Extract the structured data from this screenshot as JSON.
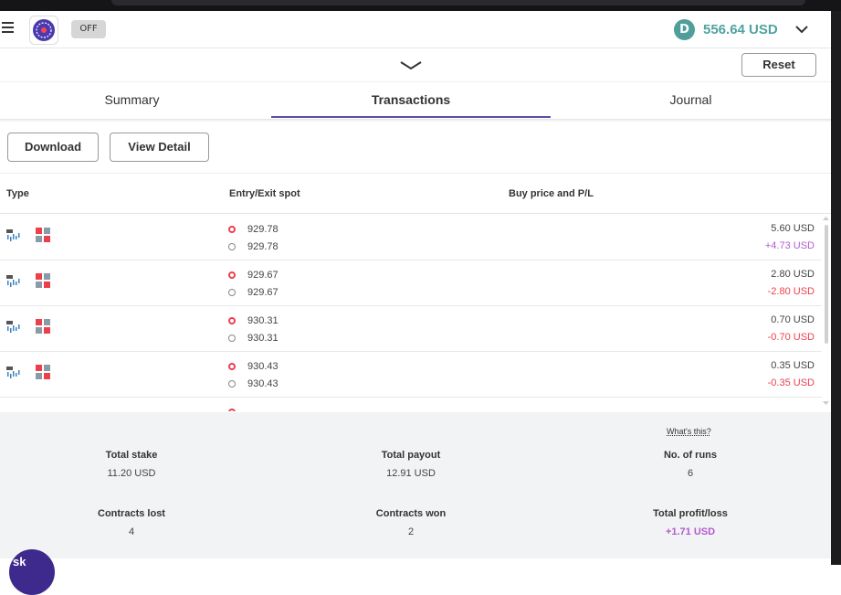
{
  "header": {
    "bot_status": "OFF",
    "balance": "556.64 USD",
    "currency_icon_letter": "D",
    "colors": {
      "balance": "#4fa3a0",
      "accent": "#5a4ea8"
    }
  },
  "toolbar": {
    "reset_label": "Reset"
  },
  "tabs": [
    {
      "label": "Summary",
      "active": false
    },
    {
      "label": "Transactions",
      "active": true
    },
    {
      "label": "Journal",
      "active": false
    }
  ],
  "actions": {
    "download_label": "Download",
    "view_detail_label": "View Detail"
  },
  "table": {
    "headers": {
      "type": "Type",
      "spot": "Entry/Exit spot",
      "pl": "Buy price and P/L"
    },
    "rows": [
      {
        "entry": "929.78",
        "exit": "929.78",
        "buy": "5.60 USD",
        "pl": "+4.73 USD",
        "result": "profit"
      },
      {
        "entry": "929.67",
        "exit": "929.67",
        "buy": "2.80 USD",
        "pl": "-2.80 USD",
        "result": "loss"
      },
      {
        "entry": "930.31",
        "exit": "930.31",
        "buy": "0.70 USD",
        "pl": "-0.70 USD",
        "result": "loss"
      },
      {
        "entry": "930.43",
        "exit": "930.43",
        "buy": "0.35 USD",
        "pl": "-0.35 USD",
        "result": "loss"
      }
    ]
  },
  "summary": {
    "whats_this": "What's this?",
    "total_stake_label": "Total stake",
    "total_stake": "11.20 USD",
    "total_payout_label": "Total payout",
    "total_payout": "12.91 USD",
    "runs_label": "No. of runs",
    "runs": "6",
    "lost_label": "Contracts lost",
    "lost": "4",
    "won_label": "Contracts won",
    "won": "2",
    "pl_label": "Total profit/loss",
    "pl": "+1.71 USD"
  },
  "chat": {
    "label": "sk"
  }
}
